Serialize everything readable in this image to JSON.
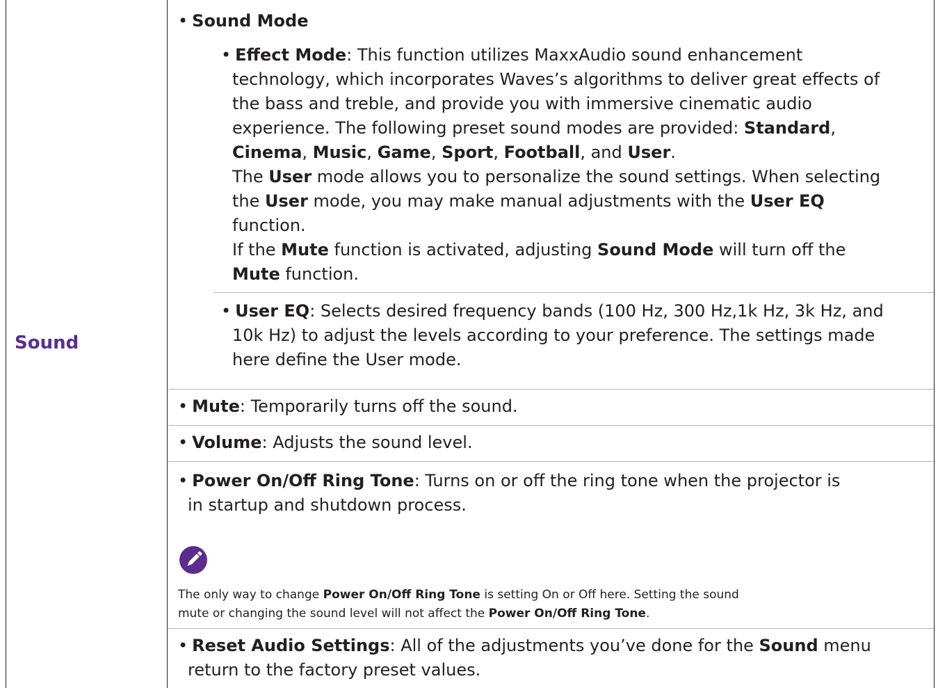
{
  "row_label": "Sound",
  "sound_mode": {
    "bullet": "•",
    "title": "Sound Mode",
    "effect_mode": {
      "bullet": "•",
      "title": "Effect Mode",
      "intro_1": ": This function utilizes MaxxAudio sound enhancement",
      "intro_2": "technology, which incorporates Waves’s algorithms to deliver great effects of",
      "intro_3": "the bass and treble, and provide you with immersive cinematic audio",
      "intro_4": "experience. The following preset sound modes are provided: ",
      "modes": [
        "Standard",
        "Cinema",
        "Music",
        "Game",
        "Sport",
        "Football",
        "User"
      ],
      "sep": ", ",
      "and": ", and ",
      "end": ".",
      "user_line_1a": "The ",
      "user_line_1b": "User",
      "user_line_1c": " mode allows you to personalize the sound settings. When selecting",
      "user_line_2a": "the ",
      "user_line_2b": "User",
      "user_line_2c": " mode, you may make manual adjustments with the ",
      "user_line_2d": "User EQ",
      "user_line_3": "function.",
      "mute_line_1a": "If the ",
      "mute_line_1b": "Mute",
      "mute_line_1c": " function is activated, adjusting ",
      "mute_line_1d": "Sound Mode",
      "mute_line_1e": " will turn off the",
      "mute_line_2a": "Mute",
      "mute_line_2b": " function."
    },
    "user_eq": {
      "bullet": "•",
      "title": "User EQ",
      "line_1": ": Selects desired frequency bands (100 Hz, 300 Hz,1k Hz, 3k Hz, and",
      "line_2": "10k Hz) to adjust the levels according to your preference. The settings made",
      "line_3": "here define the User mode."
    }
  },
  "mute": {
    "bullet": "•",
    "title": "Mute",
    "text": ": Temporarily turns off the sound."
  },
  "volume": {
    "bullet": "•",
    "title": "Volume",
    "text": ": Adjusts the sound level."
  },
  "ring_tone": {
    "bullet": "•",
    "title": "Power On/Off Ring Tone",
    "line_1": ": Turns on or off the ring tone when the projector is",
    "line_2": "in startup and shutdown process."
  },
  "note": {
    "icon": "pencil-icon",
    "line_1a": "The only way to change ",
    "line_1b": "Power On/Off Ring Tone",
    "line_1c": " is setting On or Off here. Setting the sound",
    "line_2a": "mute or changing the sound level will not affect the ",
    "line_2b": "Power On/Off Ring Tone",
    "line_2c": "."
  },
  "reset": {
    "bullet": "•",
    "title": "Reset Audio Settings",
    "line_1a": ": All of the adjustments you’ve done for the ",
    "line_1b": "Sound",
    "line_1c": " menu",
    "line_2": "return to the factory preset values."
  },
  "colors": {
    "accent": "#5b2d8e",
    "text": "#231f20",
    "divider": "#b4b4b4"
  }
}
